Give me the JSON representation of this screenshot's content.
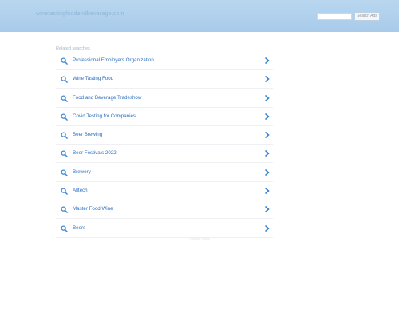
{
  "header": {
    "domain": "winetastingfoodandbeverage.com",
    "search_button": "Search Ads"
  },
  "related_label": "Related searches",
  "items": [
    {
      "label": "Professional Employers Organization"
    },
    {
      "label": "Wine Tasting Food"
    },
    {
      "label": "Food and Beverage Tradeshow"
    },
    {
      "label": "Covid Testing for Companies"
    },
    {
      "label": "Beer Brewing"
    },
    {
      "label": "Beer Festivals 2022"
    },
    {
      "label": "Brewery"
    },
    {
      "label": "Alltech"
    },
    {
      "label": "Master Food Wine"
    },
    {
      "label": "Beers"
    }
  ],
  "footer": {
    "text": "Privacy Policy"
  },
  "colors": {
    "header": "#a8cbea",
    "link": "#2c6fbd"
  }
}
